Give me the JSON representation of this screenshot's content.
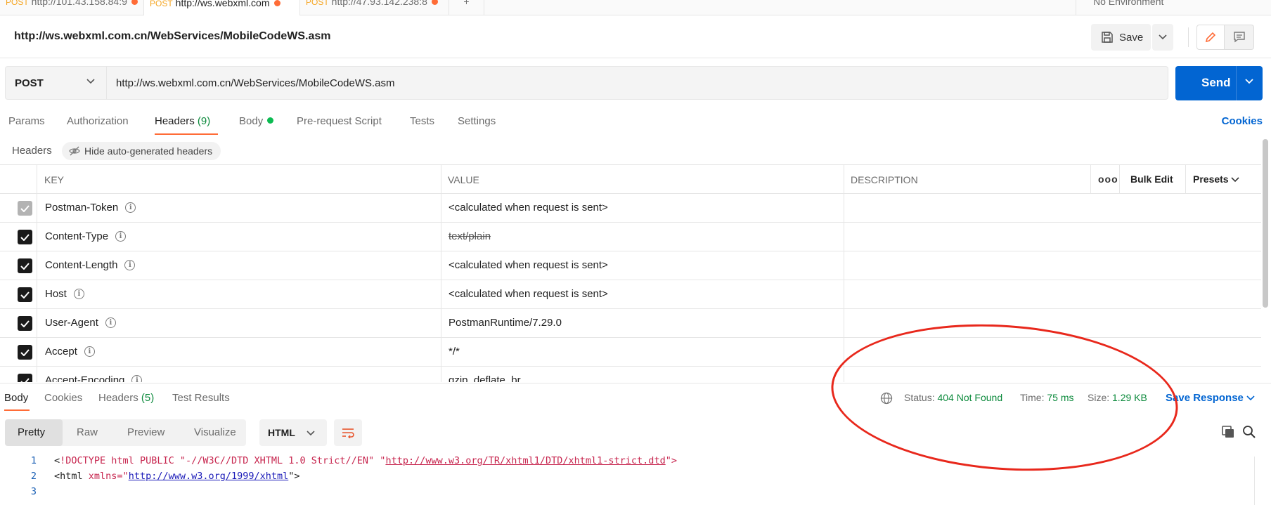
{
  "tabstrip": {
    "tabs": [
      {
        "method": "POST",
        "label": "http://101.43.158.84:9"
      },
      {
        "method": "POST",
        "label": "http://ws.webxml.com"
      },
      {
        "method": "POST",
        "label": "http://47.93.142.238:8"
      }
    ],
    "add_tab": "+",
    "environment": "No Environment"
  },
  "header": {
    "title": "http://ws.webxml.com.cn/WebServices/MobileCodeWS.asm",
    "save_label": "Save"
  },
  "request": {
    "method": "POST",
    "url": "http://ws.webxml.com.cn/WebServices/MobileCodeWS.asm",
    "send_label": "Send"
  },
  "request_tabs": {
    "params": "Params",
    "authorization": "Authorization",
    "headers": "Headers",
    "headers_count": "(9)",
    "body": "Body",
    "prerequest": "Pre-request Script",
    "tests": "Tests",
    "settings": "Settings",
    "cookies": "Cookies"
  },
  "headers_section": {
    "label": "Headers",
    "hide_auto": "Hide auto-generated headers"
  },
  "headers_table": {
    "columns": {
      "key": "KEY",
      "value": "VALUE",
      "description": "DESCRIPTION"
    },
    "more": "ooo",
    "bulk_edit": "Bulk Edit",
    "presets": "Presets",
    "rows": [
      {
        "key": "Postman-Token",
        "value": "<calculated when request is sent>",
        "checked": true,
        "disabled": true
      },
      {
        "key": "Content-Type",
        "value": "text/plain",
        "checked": true,
        "strike": true
      },
      {
        "key": "Content-Length",
        "value": "<calculated when request is sent>",
        "checked": true
      },
      {
        "key": "Host",
        "value": "<calculated when request is sent>",
        "checked": true
      },
      {
        "key": "User-Agent",
        "value": "PostmanRuntime/7.29.0",
        "checked": true
      },
      {
        "key": "Accept",
        "value": "*/*",
        "checked": true
      },
      {
        "key": "Accept-Encoding",
        "value": "gzip, deflate, br",
        "checked": true
      }
    ]
  },
  "response": {
    "tabs": {
      "body": "Body",
      "cookies": "Cookies",
      "headers": "Headers",
      "headers_count": "(5)",
      "test_results": "Test Results"
    },
    "status_label": "Status:",
    "status_value": "404 Not Found",
    "time_label": "Time:",
    "time_value": "75 ms",
    "size_label": "Size:",
    "size_value": "1.29 KB",
    "save_response": "Save Response",
    "views": {
      "pretty": "Pretty",
      "raw": "Raw",
      "preview": "Preview",
      "visualize": "Visualize"
    },
    "format": "HTML"
  },
  "code": {
    "line1_numbers": "1",
    "line2_numbers": "2",
    "line3_numbers": "3",
    "l1_open": "<",
    "l1_doctype": "!DOCTYPE",
    "l1_rest": " html PUBLIC \"-//W3C//DTD XHTML 1.0 Strict//EN\" \"",
    "l1_url": "http://www.w3.org/TR/xhtml1/DTD/xhtml1-strict.dtd",
    "l1_end": "\">",
    "l2_tag": "<html ",
    "l2_attr": "xmlns=\"",
    "l2_url": "http://www.w3.org/1999/xhtml",
    "l2_end": "\">"
  },
  "colors": {
    "accent": "#ff6c37",
    "send": "#0265d2",
    "status_green": "#0c8a3c",
    "annotation": "#e8281c"
  }
}
